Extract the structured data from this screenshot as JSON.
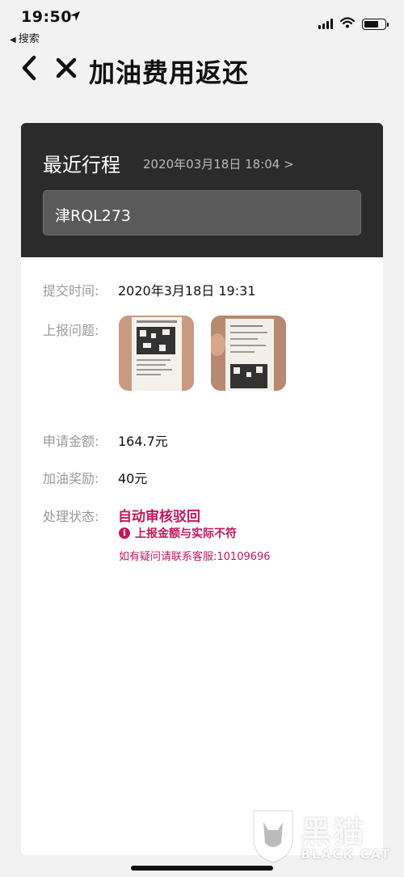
{
  "status_bar": {
    "time": "19:50",
    "back_app_label": "搜索",
    "icons": [
      "location-arrow-icon",
      "signal-icon",
      "wifi-icon",
      "battery-icon"
    ]
  },
  "nav": {
    "title": "加油费用返还",
    "back_icon": "chevron-left-icon",
    "close_icon": "close-icon"
  },
  "trip": {
    "title": "最近行程",
    "time": "2020年03月18日 18:04 >",
    "plate": "津RQL273"
  },
  "details": {
    "submit_time_label": "提交时间:",
    "submit_time_value": "2020年3月18日 19:31",
    "report_issue_label": "上报问题:",
    "images": [
      "receipt-photo-1",
      "receipt-photo-2"
    ],
    "apply_amount_label": "申请金额:",
    "apply_amount_value": "164.7元",
    "reward_label": "加油奖励:",
    "reward_value": "40元",
    "status_label": "处理状态:",
    "status_value": "自动审核驳回",
    "reason": "上报金额与实际不符",
    "contact": "如有疑问请联系客服:10109696"
  },
  "watermark": {
    "text": "黑猫",
    "sub": "BLACK CAT"
  },
  "colors": {
    "header_bg": "#2b2b2b",
    "accent": "#c2185b",
    "page_bg": "#f2f2f2"
  }
}
